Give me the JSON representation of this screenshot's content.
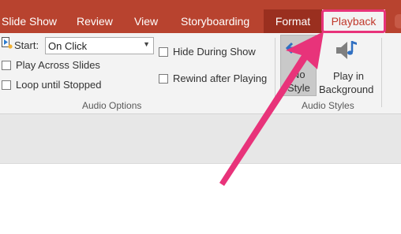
{
  "tabs": [
    {
      "label": "Slide Show"
    },
    {
      "label": "Review"
    },
    {
      "label": "View"
    },
    {
      "label": "Storyboarding"
    },
    {
      "label": "Format"
    },
    {
      "label": "Playback"
    }
  ],
  "audio_options": {
    "start_label": "Start:",
    "start_value": "On Click",
    "play_across_slides": "Play Across Slides",
    "loop_until_stopped": "Loop until Stopped",
    "hide_during_show": "Hide During Show",
    "rewind_after_playing": "Rewind after Playing",
    "group_label": "Audio Options"
  },
  "audio_styles": {
    "no_style_line1": "No",
    "no_style_line2": "Style",
    "play_bg_line1": "Play in",
    "play_bg_line2": "Background",
    "group_label": "Audio Styles"
  },
  "colors": {
    "tab_bar": "#b8432f",
    "contextual_tab": "#9a2f1f",
    "ribbon": "#f3f3f3",
    "annotation_arrow": "#e8337a"
  },
  "icons": {
    "start": "play-trigger-icon",
    "no_style": "undo-arrow-icon",
    "play_background": "speaker-music-note-icon"
  }
}
